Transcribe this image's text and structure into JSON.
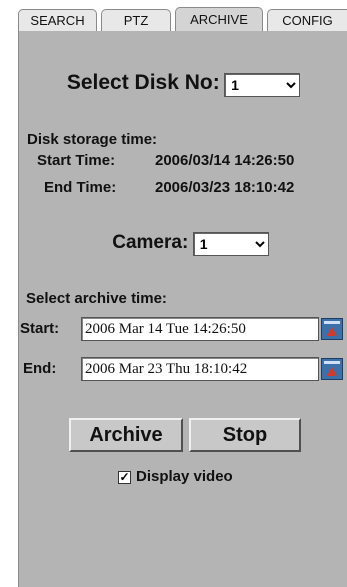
{
  "tabs": [
    {
      "label": "SEARCH"
    },
    {
      "label": "PTZ"
    },
    {
      "label": "ARCHIVE"
    },
    {
      "label": "CONFIG"
    }
  ],
  "disk": {
    "label": "Select Disk No:",
    "selected": "1"
  },
  "storage": {
    "heading": "Disk storage time:",
    "start_label": "Start Time:",
    "start_value": "2006/03/14 14:26:50",
    "end_label": "End Time:",
    "end_value": "2006/03/23 18:10:42"
  },
  "camera": {
    "label": "Camera:",
    "selected": "1"
  },
  "archive_time": {
    "heading": "Select archive time:",
    "start_label": "Start:",
    "start_value": "2006 Mar 14 Tue  14:26:50",
    "end_label": "End:",
    "end_value": "2006 Mar 23 Thu  18:10:42"
  },
  "buttons": {
    "archive": "Archive",
    "stop": "Stop"
  },
  "display_video": {
    "label": "Display video",
    "checked": true,
    "mark": "✓"
  },
  "icons": {
    "picker": "calendar-picker-icon"
  },
  "colors": {
    "panel": "#b4b4b4",
    "picker_blue": "#3d6fa8",
    "picker_arrow": "#d43a2a"
  }
}
